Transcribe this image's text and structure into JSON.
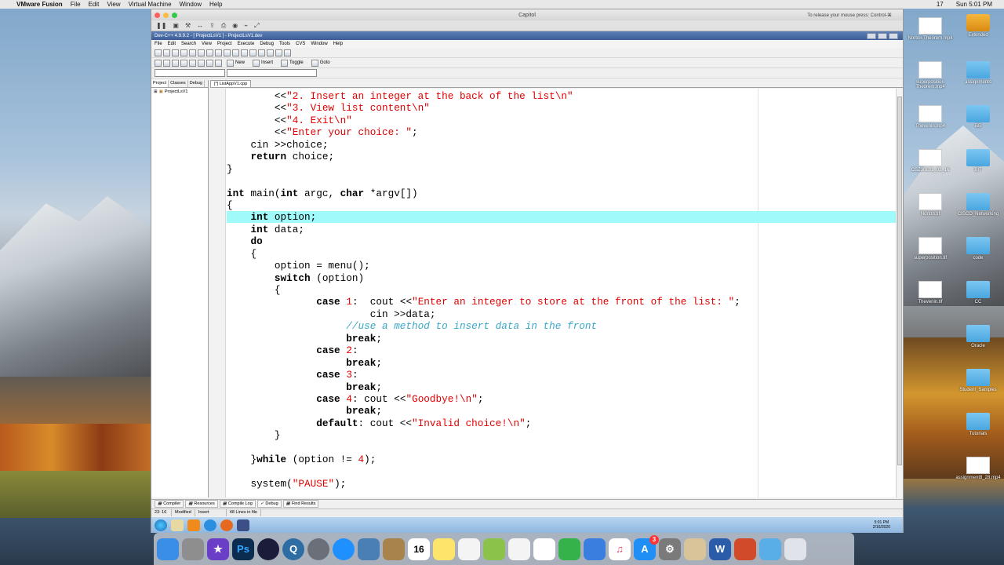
{
  "macos": {
    "app": "VMware Fusion",
    "menus": [
      "File",
      "Edit",
      "View",
      "Virtual Machine",
      "Window",
      "Help"
    ],
    "battery": "17",
    "clock": "Sun 5:01 PM"
  },
  "vm": {
    "title": "Capitol",
    "release_hint": "To release your mouse press: Control-⌘"
  },
  "devcpp": {
    "title": "Dev-C++ 4.9.9.2 - [ ProjectLsV1 ] - ProjectLsV1.dev",
    "menu": [
      "File",
      "Edit",
      "Search",
      "View",
      "Project",
      "Execute",
      "Debug",
      "Tools",
      "CVS",
      "Window",
      "Help"
    ],
    "toolbar2": {
      "new": "New",
      "insert": "Insert",
      "toggle": "Toggle",
      "goto": "Goto"
    },
    "left_tabs": [
      "Project",
      "Classes",
      "Debug"
    ],
    "tree_item": "ProjectLsV1",
    "editor_tab": "[*] ListAppV1.cpp",
    "bottom_tabs": [
      "Compiler",
      "Resources",
      "Compile Log",
      "Debug",
      "Find Results"
    ],
    "status": {
      "pos": "23: 16",
      "modified": "Modified",
      "mode": "Insert",
      "lines": "48 Lines in file"
    }
  },
  "code_lines": [
    "        <<\"2. Insert an integer at the back of the list\\n\"",
    "        <<\"3. View list content\\n\"",
    "        <<\"4. Exit\\n\"",
    "        <<\"Enter your choice: \";",
    "    cin >>choice;",
    "    return choice;",
    "}",
    "",
    "int main(int argc, char *argv[])",
    "{",
    "    int option;",
    "    int data;",
    "    do",
    "    {",
    "        option = menu();",
    "        switch (option)",
    "        {",
    "               case 1:  cout <<\"Enter an integer to store at the front of the list: \";",
    "                        cin >>data;",
    "                    //use a method to insert data in the front",
    "                    break;",
    "               case 2:",
    "                    break;",
    "               case 3:",
    "                    break;",
    "               case 4: cout <<\"Goodbye!\\n\";",
    "                    break;",
    "               default: cout <<\"Invalid choice!\\n\";",
    "        }",
    "",
    "    }while (option != 4);",
    "",
    "    system(\"PAUSE\");"
  ],
  "wintray": {
    "time": "5:01 PM",
    "date": "2/16/2020"
  },
  "desktop_icons": [
    "Norton Theorem.mp4",
    "superposition Theorem.mp4",
    "Thevenin.mp4",
    "CSZ30L01_02_16",
    "Norton.tif",
    "superposition.tif",
    "Thevenin.tif",
    "assignment8_28.mp4",
    "Extended",
    "assignments",
    "BB",
    "BIT",
    "CISCO_Networking",
    "code",
    "CC",
    "Oracle",
    "Student_Samples",
    "Tutorials"
  ],
  "dock": {
    "calendar_day": "16",
    "appstore_badge": "3"
  }
}
